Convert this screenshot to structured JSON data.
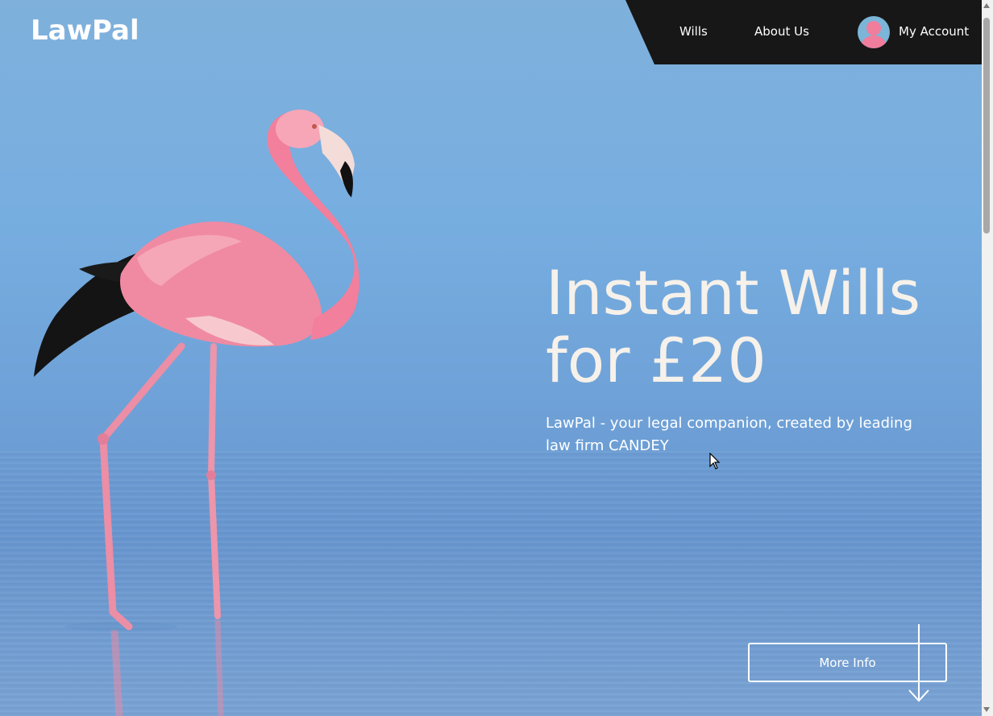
{
  "brand": {
    "logo_text": "LawPal"
  },
  "nav": {
    "links": [
      {
        "label": "Wills"
      },
      {
        "label": "About Us"
      }
    ],
    "account_label": "My Account"
  },
  "hero": {
    "headline_line1": "Instant Wills",
    "headline_line2": "for £20",
    "subtitle_line1": "LawPal - your legal companion, created by leading",
    "subtitle_line2": "law firm CANDEY",
    "cta_label": "More Info",
    "image_subject": "flamingo-wading-in-water"
  },
  "colors": {
    "navbar_bg": "#171717",
    "sky_blue": "#7aa9d6",
    "headline_text": "#f6f1ea",
    "avatar_bg": "#7bb5d8",
    "avatar_figure": "#f07d9c"
  },
  "icons": {
    "avatar": "user-avatar-icon",
    "scroll_hint": "arrow-down-icon",
    "cursor": "mouse-pointer-icon"
  }
}
